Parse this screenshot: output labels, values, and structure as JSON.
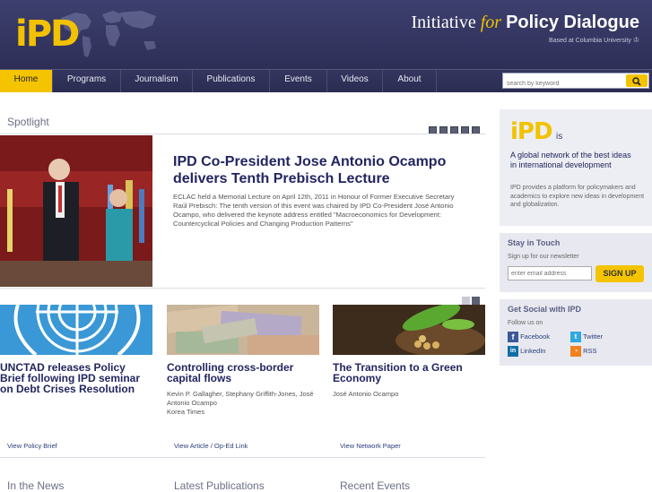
{
  "header": {
    "logo_text": "iPD",
    "org_initiative": "Initiative",
    "org_for": "for",
    "org_policy_dialogue": "Policy Dialogue",
    "org_sub": "Based at Columbia University"
  },
  "nav": {
    "items": [
      "Home",
      "Programs",
      "Journalism",
      "Publications",
      "Events",
      "Videos",
      "About"
    ],
    "active": "Home"
  },
  "search": {
    "placeholder": "search by keyword"
  },
  "spotlight": {
    "title": "Spotlight",
    "headline": "IPD Co-President Jose Antonio Ocampo delivers Tenth Prebisch Lecture",
    "body": "ECLAC held a Memorial Lecture on April 12th, 2011 in Honour of Former Executive Secretary Raúl Prebisch: The tenth version of this event was chaired by IPD Co-President José Antonio Ocampo, who delivered the keynote address entitled \"Macroeconomics for Development: Countercyclical Policies and Changing Production Patterns\""
  },
  "cards": [
    {
      "title": "UNCTAD releases Policy Brief following IPD seminar on Debt Crises Resolution",
      "meta": "",
      "link": "View Policy Brief"
    },
    {
      "title": "Controlling cross-border capital flows",
      "meta": "Kevin P. Gallagher, Stephany Griffith-Jones, José Antonio Ocampo\nKorea Times",
      "link": "View Article / Op-Ed Link"
    },
    {
      "title": "The Transition to a Green Economy",
      "meta": "José Antonio Ocampo",
      "link": "View Network Paper"
    }
  ],
  "bottom": {
    "news": "In the News",
    "publications": "Latest Publications",
    "events": "Recent Events"
  },
  "sidebar": {
    "about": {
      "logo": "iPD",
      "is": "is",
      "tagline": "A global network of the best ideas in international development",
      "desc": "IPD provides a platform for policymakers and academics to explore new ideas in development and globalization."
    },
    "stay": {
      "title": "Stay in Touch",
      "signup": "Sign up for our newsletter",
      "email_placeholder": "enter email address",
      "button": "SIGN UP"
    },
    "social": {
      "title": "Get Social with IPD",
      "follow": "Follow us on",
      "links": [
        "Facebook",
        "Twitter",
        "LinkedIn",
        "RSS"
      ]
    }
  },
  "colors": {
    "accent": "#f4c400",
    "nav": "#2e2f57",
    "headline": "#232560"
  }
}
